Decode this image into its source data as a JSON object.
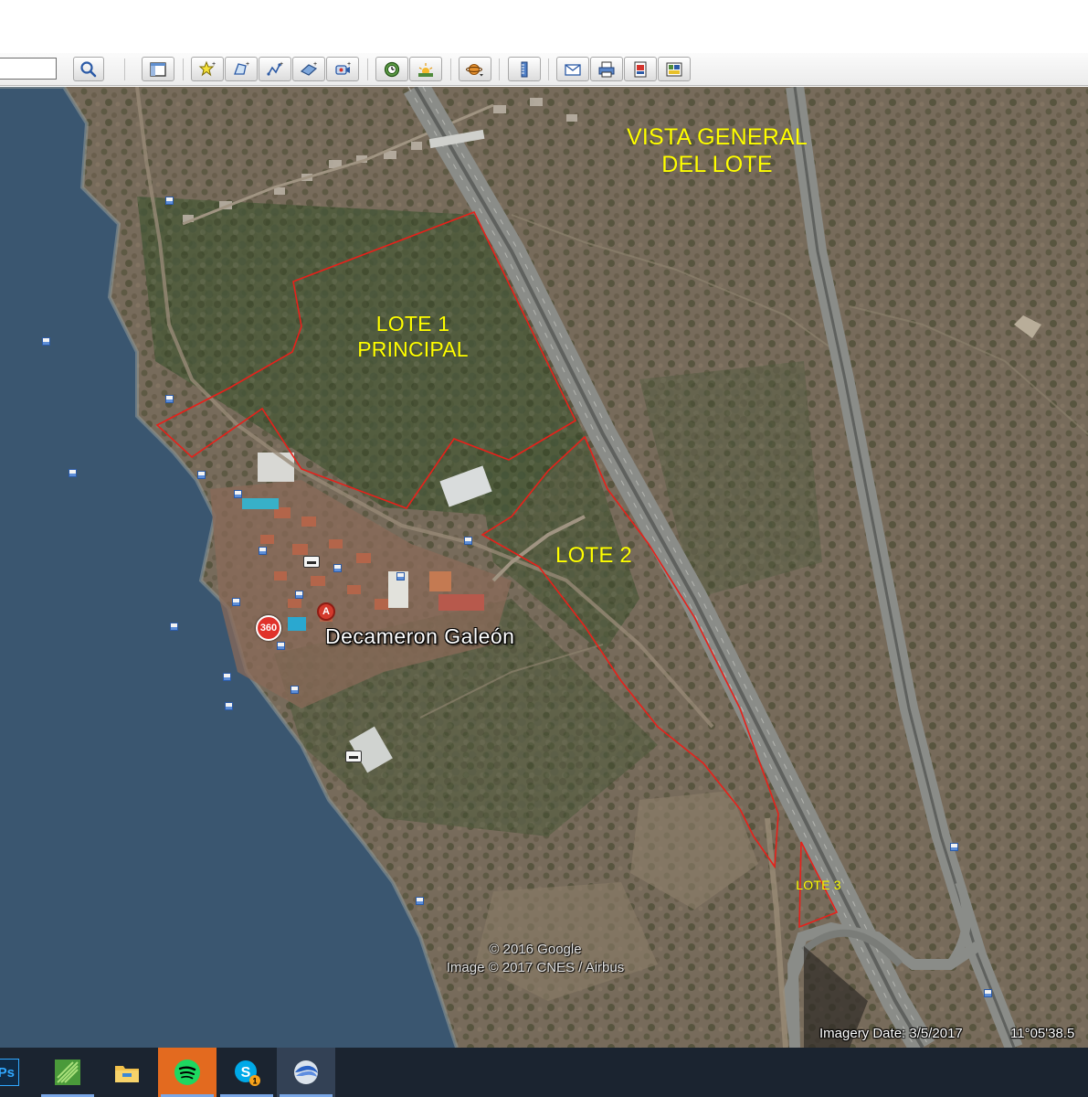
{
  "toolbar": {
    "search_value": "",
    "buttons": [
      {
        "name": "search-icon"
      },
      {
        "name": "sidebar-toggle-icon"
      },
      {
        "name": "add-placemark-icon"
      },
      {
        "name": "add-polygon-icon"
      },
      {
        "name": "add-path-icon"
      },
      {
        "name": "add-image-overlay-icon"
      },
      {
        "name": "record-tour-icon"
      },
      {
        "name": "historical-imagery-icon"
      },
      {
        "name": "sunlight-icon"
      },
      {
        "name": "planets-icon"
      },
      {
        "name": "ruler-icon"
      },
      {
        "name": "email-icon"
      },
      {
        "name": "print-icon"
      },
      {
        "name": "save-image-icon"
      },
      {
        "name": "view-in-maps-icon"
      }
    ]
  },
  "map": {
    "labels": {
      "vista_line1": "VISTA GENERAL",
      "vista_line2": "DEL LOTE",
      "lote1_line1": "LOTE 1",
      "lote1_line2": "PRINCIPAL",
      "lote2": "LOTE 2",
      "lote3": "LOTE 3"
    },
    "place_name": "Decameron Galeón",
    "pin_letter": "A",
    "badge_360": "360",
    "copyright_line1": "© 2016 Google",
    "copyright_line2": "Image © 2017 CNES / Airbus",
    "imagery_date": "Imagery Date: 3/5/2017",
    "coordinates": "11°05'38.5",
    "colors": {
      "label": "#ffff00",
      "boundary": "#e8201a",
      "water": "#3a5670",
      "land": "#766a5a"
    }
  },
  "taskbar": {
    "ps_label": "Ps",
    "skype_badge": "1",
    "apps": [
      {
        "name": "photoshop-icon"
      },
      {
        "name": "app-green-icon"
      },
      {
        "name": "file-explorer-icon"
      },
      {
        "name": "spotify-icon"
      },
      {
        "name": "skype-icon"
      },
      {
        "name": "google-earth-icon"
      }
    ]
  }
}
